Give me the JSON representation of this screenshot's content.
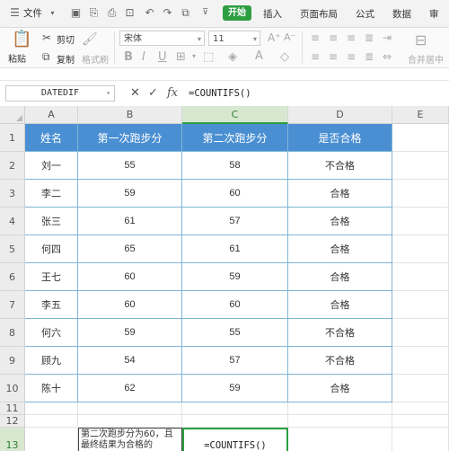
{
  "menu": {
    "file_label": "文件",
    "tabs": [
      "开始",
      "插入",
      "页面布局",
      "公式",
      "数据",
      "审"
    ],
    "active_tab": "开始"
  },
  "ribbon": {
    "paste": "粘贴",
    "cut": "剪切",
    "copy": "复制",
    "format_painter": "格式刷",
    "font_name": "宋体",
    "font_size": "11",
    "merge_center": "合并居中"
  },
  "formula_bar": {
    "name_box": "DATEDIF",
    "fx": "fx",
    "formula": "=COUNTIFS()"
  },
  "sheet": {
    "columns": [
      "A",
      "B",
      "C",
      "D",
      "E"
    ],
    "selected_column": "C",
    "rows": [
      "1",
      "2",
      "3",
      "4",
      "5",
      "6",
      "7",
      "8",
      "9",
      "10",
      "11",
      "12",
      "13"
    ],
    "selected_row": "13",
    "headers": [
      "姓名",
      "第一次跑步分",
      "第二次跑步分",
      "是否合格"
    ],
    "data": [
      [
        "刘一",
        "55",
        "58",
        "不合格"
      ],
      [
        "李二",
        "59",
        "60",
        "合格"
      ],
      [
        "张三",
        "61",
        "57",
        "合格"
      ],
      [
        "何四",
        "65",
        "61",
        "合格"
      ],
      [
        "王七",
        "60",
        "59",
        "合格"
      ],
      [
        "李五",
        "60",
        "60",
        "合格"
      ],
      [
        "何六",
        "59",
        "55",
        "不合格"
      ],
      [
        "顾九",
        "54",
        "57",
        "不合格"
      ],
      [
        "陈十",
        "62",
        "59",
        "合格"
      ]
    ],
    "note_text": "第二次跑步分为60，且最终结果为合格的",
    "active_cell_text": "=COUNTIFS()"
  }
}
